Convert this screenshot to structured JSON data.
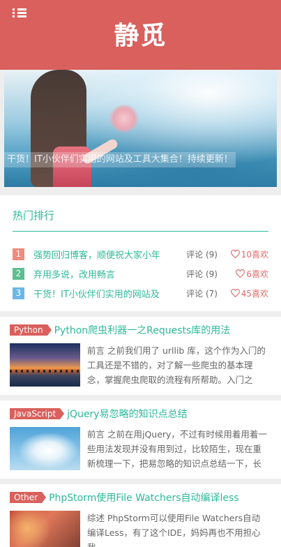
{
  "header": {
    "title": "静觅",
    "menu_icon": "menu-icon"
  },
  "banner": {
    "caption": "干货！IT小伙伴们实用的网站及工具大集合！持续更新！"
  },
  "hot": {
    "title": "热门排行",
    "items": [
      {
        "rank": "1",
        "rank_color": "#f08a7d",
        "name": "强势回归博客，顺便祝大家小年",
        "comments": "评论 (9)",
        "likes": "10喜欢"
      },
      {
        "rank": "2",
        "rank_color": "#5bbf8f",
        "name": "弃用多说，改用畅言",
        "comments": "评论 (9)",
        "likes": "6喜欢"
      },
      {
        "rank": "3",
        "rank_color": "#6bb7e8",
        "name": "干货！IT小伙伴们实用的网站及",
        "comments": "评论 (7)",
        "likes": "45喜欢"
      }
    ]
  },
  "articles": [
    {
      "tag": "Python",
      "title": "Python爬虫利器一之Requests库的用法",
      "excerpt": "前言 之前我们用了 urllib 库，这个作为入门的工具还是不错的，对了解一些爬虫的基本理念，掌握爬虫爬取的流程有所帮助。入门之"
    },
    {
      "tag": "JavaScript",
      "title": "jQuery易忽略的知识点总结",
      "excerpt": "前言 之前在用jQuery，不过有时候用着用着一些用法发现并没有用到过，比较陌生，现在重新梳理一下，把易忽略的知识点总结一下，长"
    },
    {
      "tag": "Other",
      "title": "PhpStorm使用File Watchers自动编译less",
      "excerpt": "综述 PhpStorm可以使用File Watchers自动编译Less，有了这个IDE，妈妈再也不用担心我"
    }
  ],
  "colors": {
    "primary": "#d9605c",
    "accent": "#2db99a",
    "like": "#e06a6a"
  }
}
